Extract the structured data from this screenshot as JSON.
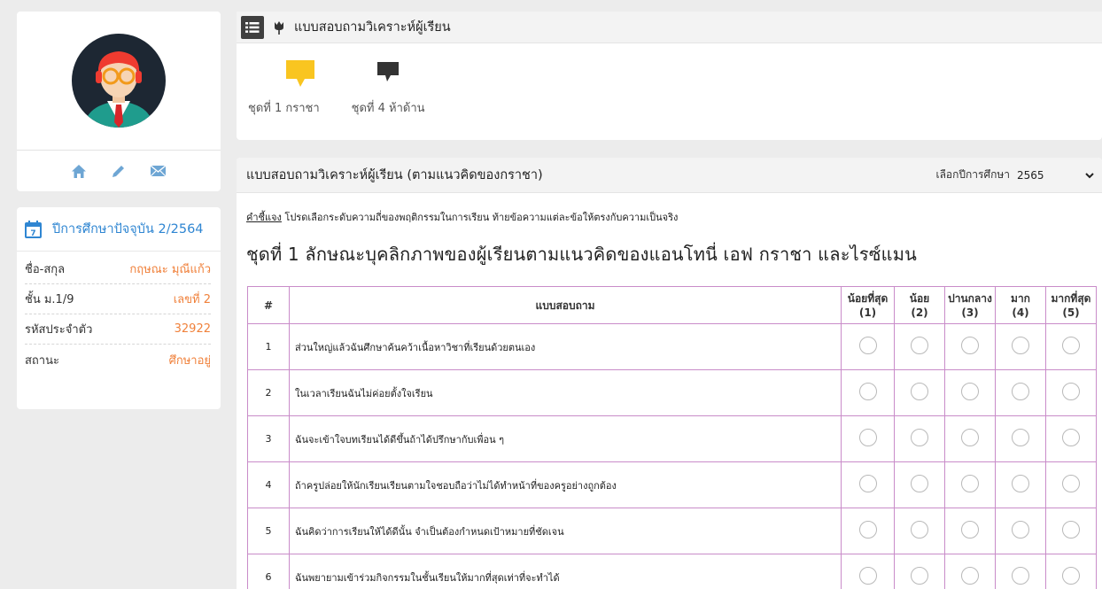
{
  "profile": {
    "avatar_icon": "teacher-avatar-icon",
    "actions": [
      "home-icon",
      "pencil-icon",
      "envelope-icon"
    ]
  },
  "info": {
    "title": "ปีการศึกษาปัจจุบัน 2/2564",
    "calendar_day": "7",
    "rows": [
      {
        "label": "ชื่อ-สกุล",
        "value": "กฤษณะ มุณีแก้ว"
      },
      {
        "label": "ชั้น ม.1/9",
        "value": "เลขที่ 2"
      },
      {
        "label": "รหัสประจำตัว",
        "value": "32922"
      },
      {
        "label": "สถานะ",
        "value": "ศึกษาอยู่"
      }
    ]
  },
  "header": {
    "title": "แบบสอบถามวิเคราะห์ผู้เรียน",
    "tabs": [
      {
        "label": "ชุดที่ 1 กราชา",
        "icon": "speech-bubble-icon",
        "color": "#f9c520"
      },
      {
        "label": "ชุดที่ 4 ห้าด้าน",
        "icon": "speech-bubble-icon",
        "color": "#333333"
      }
    ]
  },
  "main": {
    "title": "แบบสอบถามวิเคราะห์ผู้เรียน (ตามแนวคิดของกราชา)",
    "year_label": "เลือกปีการศึกษา",
    "year_value": "2565",
    "instruction_key": "คำชี้แจง",
    "instruction_text": " โปรดเลือกระดับความถี่ของพฤติกรรมในการเรียน ท้ายข้อความแต่ละข้อให้ตรงกับความเป็นจริง",
    "set_title": "ชุดที่ 1 ลักษณะบุคลิกภาพของผู้เรียนตามแนวคิดของแอนโทนี่ เอฟ กราชา และไรซ์แมน",
    "columns": {
      "num": "#",
      "question": "แบบสอบถาม",
      "levels": [
        {
          "name": "น้อยที่สุด",
          "score": "(1)"
        },
        {
          "name": "น้อย",
          "score": "(2)"
        },
        {
          "name": "ปานกลาง",
          "score": "(3)"
        },
        {
          "name": "มาก",
          "score": "(4)"
        },
        {
          "name": "มากที่สุด",
          "score": "(5)"
        }
      ]
    },
    "questions": [
      {
        "num": "1",
        "text": "ส่วนใหญ่แล้วฉันศึกษาค้นคว้าเนื้อหาวิชาที่เรียนด้วยตนเอง"
      },
      {
        "num": "2",
        "text": "ในเวลาเรียนฉันไม่ค่อยตั้งใจเรียน"
      },
      {
        "num": "3",
        "text": "ฉันจะเข้าใจบทเรียนได้ดีขึ้นถ้าได้ปรึกษากับเพื่อน ๆ"
      },
      {
        "num": "4",
        "text": "ถ้าครูปล่อยให้นักเรียนเรียนตามใจชอบถือว่าไม่ได้ทำหน้าที่ของครูอย่างถูกต้อง"
      },
      {
        "num": "5",
        "text": "ฉันคิดว่าการเรียนให้ได้ดีนั้น จำเป็นต้องกำหนดเป้าหมายที่ชัดเจน"
      },
      {
        "num": "6",
        "text": "ฉันพยายามเข้าร่วมกิจกรรมในชั้นเรียนให้มากที่สุดเท่าที่จะทำได้"
      }
    ]
  }
}
